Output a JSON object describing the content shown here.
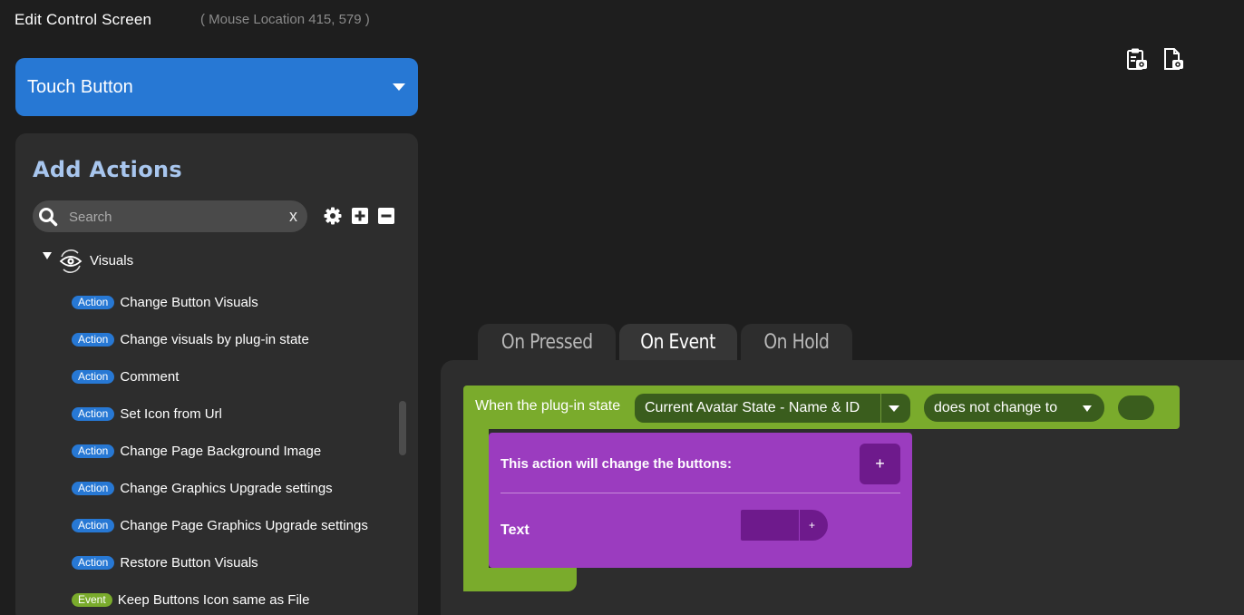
{
  "header": {
    "title": "Edit Control Screen",
    "mouse_location": "( Mouse Location 415, 579 )"
  },
  "toolbar_icons": [
    "clipboard-camera-icon",
    "document-camera-icon"
  ],
  "control_type": {
    "selected": "Touch Button"
  },
  "actions_panel": {
    "title": "Add Actions",
    "search": {
      "placeholder": "Search",
      "value": "",
      "clear_label": "x"
    },
    "tools": [
      "gear-icon",
      "expand-all-icon",
      "collapse-all-icon"
    ],
    "category": {
      "label": "Visuals",
      "icon": "eye-icon",
      "expanded": true,
      "items": [
        {
          "type": "Action",
          "label": "Change Button Visuals"
        },
        {
          "type": "Action",
          "label": "Change visuals by plug-in state"
        },
        {
          "type": "Action",
          "label": "Comment"
        },
        {
          "type": "Action",
          "label": "Set Icon from Url"
        },
        {
          "type": "Action",
          "label": "Change Page Background Image"
        },
        {
          "type": "Action",
          "label": "Change Graphics Upgrade settings"
        },
        {
          "type": "Action",
          "label": "Change Page Graphics Upgrade settings"
        },
        {
          "type": "Action",
          "label": "Restore Button Visuals"
        },
        {
          "type": "Event",
          "label": "Keep Buttons Icon same as File"
        }
      ]
    }
  },
  "tabs": [
    {
      "label": "On Pressed",
      "active": false
    },
    {
      "label": "On Event",
      "active": true
    },
    {
      "label": "On Hold",
      "active": false
    }
  ],
  "event_block": {
    "label": "When the plug-in state",
    "state_select": "Current Avatar State - Name & ID",
    "condition_select": "does not change to",
    "value": ""
  },
  "action_block": {
    "title": "This action will change the buttons:",
    "add_label": "+",
    "text_label": "Text",
    "text_value": "",
    "text_plus_label": "+"
  },
  "colors": {
    "background": "#1e1e1e",
    "panel": "#2d2d2d",
    "accent_blue": "#2778d4",
    "event_green": "#7aab2c",
    "action_purple": "#9b3cbf"
  }
}
